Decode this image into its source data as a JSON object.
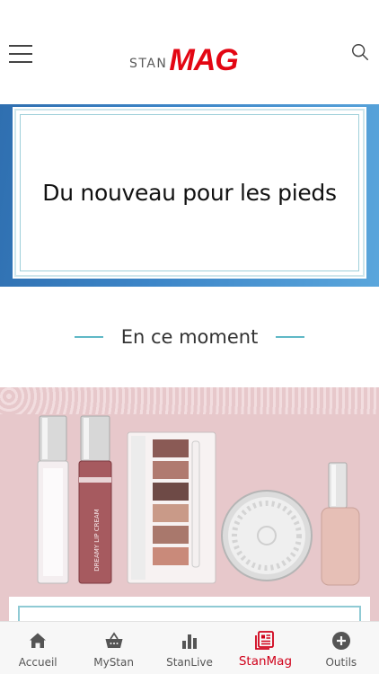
{
  "header": {
    "logo_stan": "STAN",
    "logo_mag": "MAG",
    "menu_icon": "hamburger-menu-icon",
    "search_icon": "search-icon"
  },
  "banner": {
    "title": "Du nouveau pour les pieds"
  },
  "section": {
    "title": "En ce moment"
  },
  "feature": {
    "product_text": "DREAMY LIP CREAM"
  },
  "tabbar": {
    "active_color": "#d0021b",
    "items": [
      {
        "label": "Accueil",
        "icon": "home-icon"
      },
      {
        "label": "MyStan",
        "icon": "basket-icon"
      },
      {
        "label": "StanLive",
        "icon": "bar-chart-icon"
      },
      {
        "label": "StanMag",
        "icon": "newspaper-icon",
        "active": true
      },
      {
        "label": "Outils",
        "icon": "plus-circle-icon"
      }
    ]
  }
}
